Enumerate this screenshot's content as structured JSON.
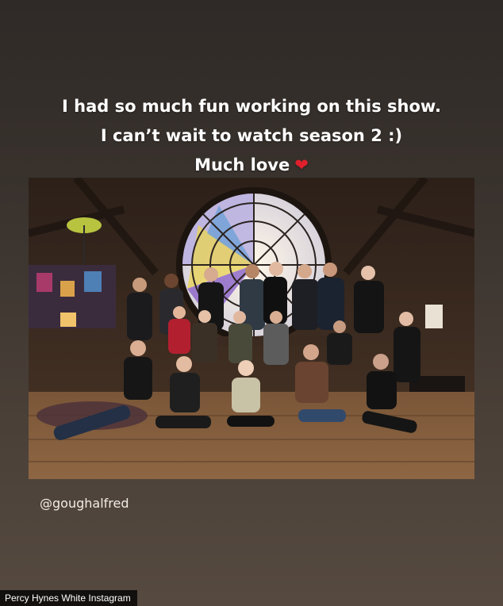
{
  "story": {
    "line1": "I had so much fun working on this show.",
    "line2": "I can’t wait to watch season 2 :)",
    "line3": "Much love",
    "heart_icon": "heart-emoji"
  },
  "photo": {
    "subject": "cast-group-photo"
  },
  "mention": "@goughalfred",
  "credit": "Percy Hynes White Instagram",
  "colors": {
    "background_top": "#2f2a27",
    "background_bottom": "#564a40",
    "text": "#ffffff",
    "heart": "#e0202c"
  }
}
